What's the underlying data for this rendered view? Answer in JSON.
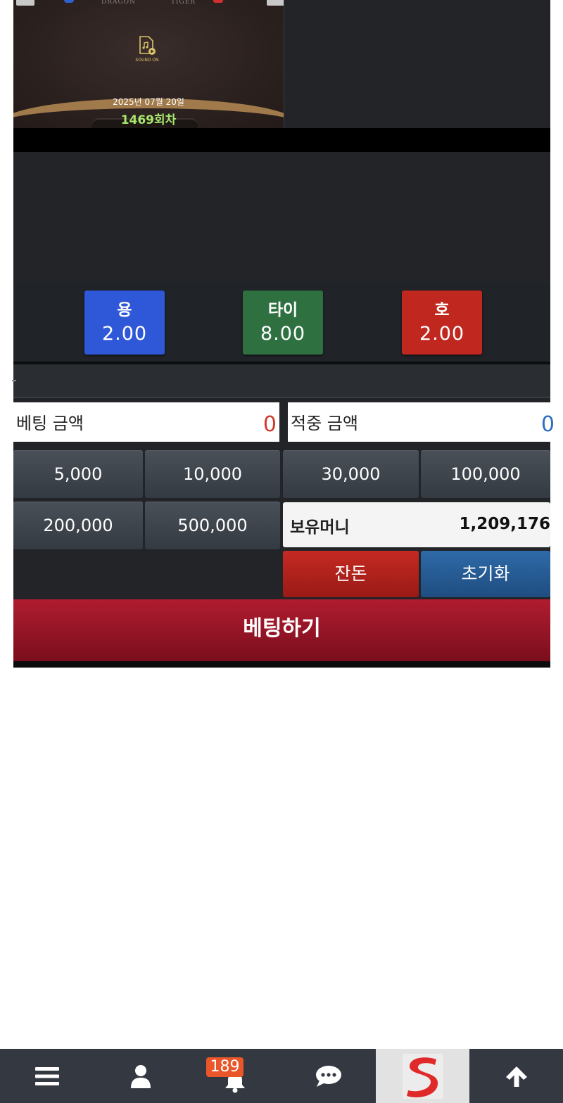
{
  "video": {
    "table_labels": [
      "DRAGON",
      "TIGER"
    ],
    "sound_label": "SOUND ON",
    "date": "2025년 07월 20일",
    "round": "1469회차"
  },
  "bets": [
    {
      "name": "용",
      "odds": "2.00",
      "color": "#2f58d8"
    },
    {
      "name": "타이",
      "odds": "8.00",
      "color": "#2e7040"
    },
    {
      "name": "호",
      "odds": "2.00",
      "color": "#c0281f"
    }
  ],
  "amounts": {
    "bet_label": "베팅 금액",
    "bet_value": "0",
    "win_label": "적중 금액",
    "win_value": "0"
  },
  "chips": [
    "5,000",
    "10,000",
    "30,000",
    "100,000",
    "200,000",
    "500,000"
  ],
  "money": {
    "label": "보유머니",
    "value": "1,209,176"
  },
  "actions": {
    "change_label": "잔돈",
    "reset_label": "초기화",
    "place_bet_label": "베팅하기"
  },
  "nav": {
    "notification_count": "189",
    "items": [
      "menu-icon",
      "user-icon",
      "bell-icon",
      "chat-icon",
      "logo",
      "arrow-up-icon"
    ]
  }
}
